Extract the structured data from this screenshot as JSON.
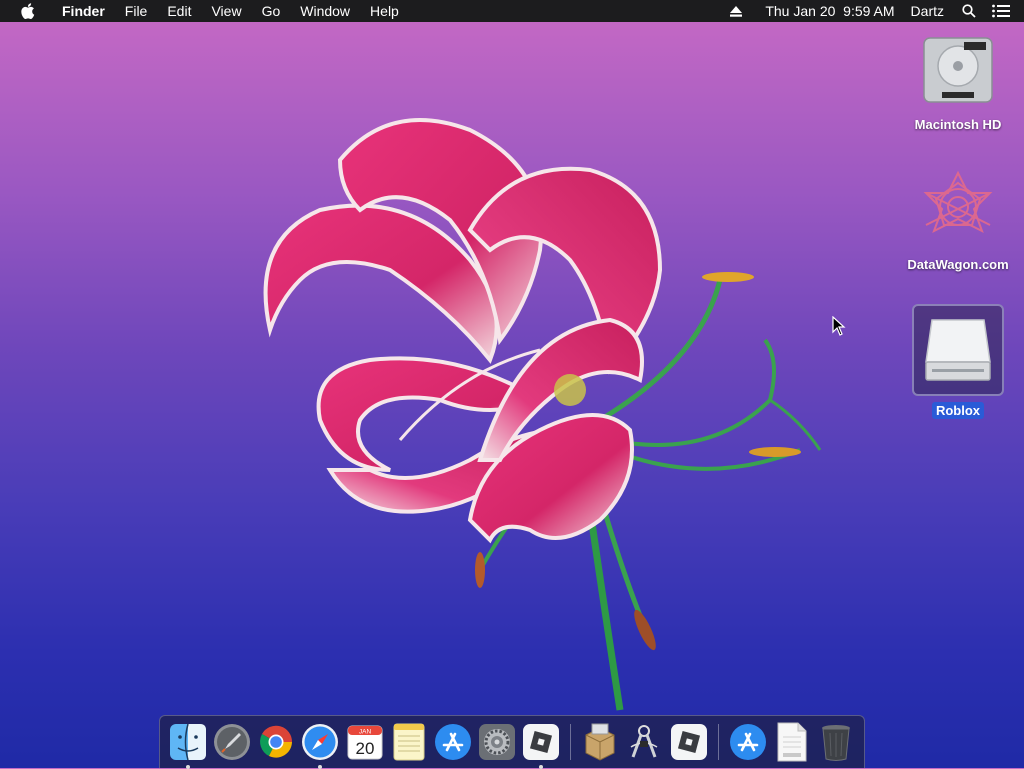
{
  "menubar": {
    "app_name": "Finder",
    "menus": [
      "File",
      "Edit",
      "View",
      "Go",
      "Window",
      "Help"
    ],
    "clock": "Thu Jan 20  9:59 AM",
    "user": "Dartz"
  },
  "desktop": {
    "icons": [
      {
        "label": "Macintosh HD",
        "icon": "hard-drive-icon"
      },
      {
        "label": "DataWagon.com",
        "icon": "datawagon-logo-icon"
      },
      {
        "label": "Roblox",
        "icon": "removable-disk-icon",
        "selected": true
      }
    ]
  },
  "dock": {
    "calendar_month": "JAN",
    "calendar_day": "20",
    "items": [
      "finder-icon",
      "launchpad-icon",
      "chrome-icon",
      "safari-icon",
      "calendar-icon",
      "notes-icon",
      "app-store-icon",
      "system-preferences-icon",
      "roblox-icon",
      "installer-icon",
      "instruments-icon",
      "roblox-studio-icon",
      "downloads-app-store-icon",
      "html-document-icon",
      "trash-icon"
    ]
  },
  "colors": {
    "menubar_bg": "#1c1c1e",
    "selection_blue": "#2a5bd7"
  }
}
